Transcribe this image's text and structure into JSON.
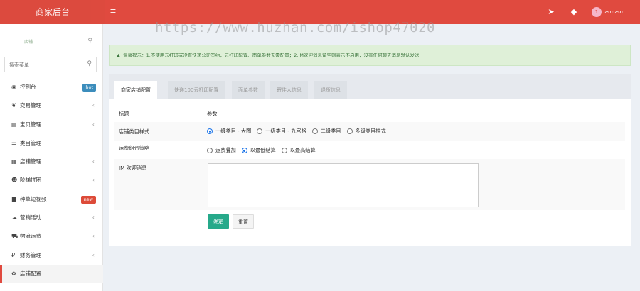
{
  "header": {
    "brand": "商家后台",
    "menu_icon": "bars-icon",
    "icons": [
      "send-icon",
      "chat-icon"
    ],
    "user_avatar": "1",
    "username": "zsmzsm"
  },
  "watermark": "https://www.huzhan.com/ishop47020",
  "sidebar": {
    "top_label": "店铺",
    "search_placeholder": "搜索菜单",
    "items": [
      {
        "label": "控制台",
        "icon": "dashboard-icon",
        "glyph": "◉",
        "badge": "hot",
        "badge_color": "#3c8dbc"
      },
      {
        "label": "交易管理",
        "icon": "leaf-icon",
        "glyph": "❦",
        "chevron": "‹"
      },
      {
        "label": "宝贝管理",
        "icon": "shopping-bag-icon",
        "glyph": "▤",
        "chevron": "‹"
      },
      {
        "label": "类目管理",
        "icon": "list-icon",
        "glyph": "☰"
      },
      {
        "label": "店铺管理",
        "icon": "store-icon",
        "glyph": "▦",
        "chevron": "‹"
      },
      {
        "label": "阶梯拼团",
        "icon": "users-icon",
        "glyph": "☻",
        "chevron": "‹"
      },
      {
        "label": "种草短视频",
        "icon": "video-icon",
        "glyph": "■",
        "badge": "new",
        "badge_color": "#dd4b39"
      },
      {
        "label": "营销活动",
        "icon": "cloud-icon",
        "glyph": "☁",
        "chevron": "‹"
      },
      {
        "label": "物流运费",
        "icon": "truck-icon",
        "glyph": "⛟",
        "chevron": "‹"
      },
      {
        "label": "财务管理",
        "icon": "money-icon",
        "glyph": "₽",
        "chevron": "‹"
      },
      {
        "label": "店铺配置",
        "icon": "gear-icon",
        "glyph": "✿",
        "active": true
      }
    ]
  },
  "alert": {
    "icon": "warning-icon",
    "glyph": "▲",
    "text": "温馨提示：1.不使用云打印或没有快递公司签约，云打印配置、面单参数无需配置；2.IM欢迎消息留空则表示不启用，没有任何聊天消息默认发送"
  },
  "tabs": [
    {
      "label": "商家店铺配置",
      "active": true
    },
    {
      "label": "快递100云打印配置"
    },
    {
      "label": "面单参数"
    },
    {
      "label": "寄件人信息"
    },
    {
      "label": "退货信息"
    }
  ],
  "table": {
    "header": {
      "col1": "标题",
      "col2": "参数"
    },
    "rows": [
      {
        "title": "店铺类目样式",
        "options": [
          {
            "label": "一级类目 - 大图",
            "checked": true
          },
          {
            "label": "一级类目 - 九宫格",
            "checked": false
          },
          {
            "label": "二级类目",
            "checked": false
          },
          {
            "label": "多级类目样式",
            "checked": false
          }
        ]
      },
      {
        "title": "运费组合策略",
        "options": [
          {
            "label": "运费叠加",
            "checked": false
          },
          {
            "label": "以最低结算",
            "checked": true
          },
          {
            "label": "以最高结算",
            "checked": false
          }
        ]
      },
      {
        "title": "IM 欢迎消息",
        "value": ""
      }
    ]
  },
  "buttons": {
    "confirm": "确定",
    "reset": "重置"
  }
}
